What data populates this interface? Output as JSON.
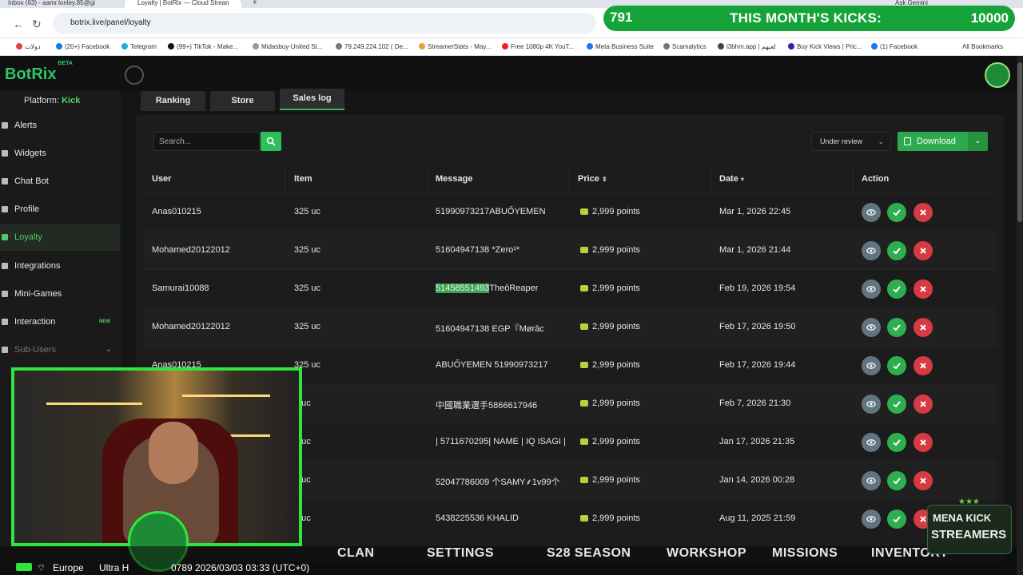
{
  "browser": {
    "tabs": [
      {
        "label": "Inbox (63) - aamr.lonley.85@gi"
      },
      {
        "label": "Loyalty | BotRix — Cloud Strean"
      }
    ],
    "url": "botrix.live/panel/loyalty",
    "bookmarks": [
      "دولات",
      "(20+) Facebook",
      "Telegram",
      "(99+) TikTok - Make...",
      "Midasbuy-United St...",
      "79.249.224.102 ( De...",
      "StreamerStats - May...",
      "Free 1080p 4K YouT...",
      "Meta Business Suite",
      "Scamalytics",
      "l3bhm.app | لعبهم",
      "Buy Kick Views | Pric...",
      "(1) Facebook",
      "All Bookmarks"
    ],
    "ask_gemini": "Ask Gemini"
  },
  "kicks_overlay": {
    "count": "791",
    "label": "THIS MONTH'S KICKS:",
    "goal": "10000"
  },
  "app": {
    "logo": "BotRix",
    "logo_tag": "BETA",
    "platform_label": "Platform:",
    "platform_value": "Kick"
  },
  "sidebar": {
    "items": [
      {
        "label": "Alerts"
      },
      {
        "label": "Widgets"
      },
      {
        "label": "Chat Bot"
      },
      {
        "label": "Profile"
      },
      {
        "label": "Loyalty"
      },
      {
        "label": "Integrations"
      },
      {
        "label": "Mini-Games"
      },
      {
        "label": "Interaction",
        "badge": "NEW"
      },
      {
        "label": "Sub-Users"
      }
    ]
  },
  "tabs": [
    {
      "label": "Ranking"
    },
    {
      "label": "Store"
    },
    {
      "label": "Sales log"
    }
  ],
  "toolbar": {
    "search_placeholder": "Search...",
    "filter_value": "Under review",
    "download_label": "Download"
  },
  "table": {
    "headers": [
      "User",
      "Item",
      "Message",
      "Price",
      "Date",
      "Action"
    ],
    "rows": [
      {
        "user": "Anas010215",
        "item": "325 uc",
        "message": "51990973217ABUŐYEMEN",
        "price": "2,999 points",
        "date": "Mar 1, 2026 22:45"
      },
      {
        "user": "Mohamed20122012",
        "item": "325 uc",
        "message": "51604947138 *Zero¹*",
        "price": "2,999 points",
        "date": "Mar 1, 2026 21:44"
      },
      {
        "user": "Samurai10088",
        "item": "325 uc",
        "message_hl": "51458551493",
        "message": "TheôReaper",
        "price": "2,999 points",
        "date": "Feb 19, 2026 19:54"
      },
      {
        "user": "Mohamed20122012",
        "item": "325 uc",
        "message": "51604947138 EGP『Mørāc",
        "price": "2,999 points",
        "date": "Feb 17, 2026 19:50"
      },
      {
        "user": "Anas010215",
        "item": "325 uc",
        "message": "ABUŐYEMEN 51990973217",
        "price": "2,999 points",
        "date": "Feb 17, 2026 19:44"
      },
      {
        "user": "",
        "item": "5 uc",
        "message": "中國職業選手5866617946",
        "price": "2,999 points",
        "date": "Feb 7, 2026 21:30"
      },
      {
        "user": "",
        "item": "5 uc",
        "message": "| 5711670295| NAME | IQ ISAGI |",
        "price": "2,999 points",
        "date": "Jan 17, 2026 21:35"
      },
      {
        "user": "",
        "item": "5 uc",
        "message": "52047786009 个SAMY⸙1v99个",
        "price": "2,999 points",
        "date": "Jan 14, 2026 00:28"
      },
      {
        "user": "",
        "item": "5 uc",
        "message": "5438225536 KHALID",
        "price": "2,999 points",
        "date": "Aug 11, 2025 21:59"
      }
    ]
  },
  "game_bar": {
    "items": [
      "CLAN",
      "SETTINGS",
      "S28 SEASON",
      "WORKSHOP",
      "MISSIONS",
      "INVENTORY"
    ]
  },
  "stream_status": {
    "region": "Europe",
    "quality": "Ultra H",
    "timestamp": "0789 2026/03/03 03:33 (UTC+0)"
  },
  "mena_logo": {
    "line1": "MENA KICK",
    "line2": "STREAMERS"
  },
  "colors": {
    "accent": "#2fa94d",
    "danger": "#d83a43",
    "view": "#617480",
    "kicks_bg": "#16a33a"
  }
}
